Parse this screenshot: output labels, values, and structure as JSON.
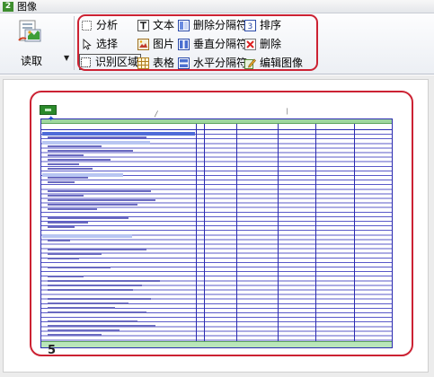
{
  "window": {
    "app_icon_text": "2",
    "title": "图像"
  },
  "ribbon": {
    "read_button": {
      "label": "读取",
      "icon": "scanner-read-icon",
      "dropdown_icon": "dropdown-arrow-icon"
    },
    "tools": [
      {
        "id": "analyze",
        "label": "分析",
        "icon": "analyze-frame-icon"
      },
      {
        "id": "select",
        "label": "选择",
        "icon": "cursor-arrow-icon"
      },
      {
        "id": "recognize",
        "label": "识别区域",
        "icon": "dashed-region-icon",
        "active": true
      },
      {
        "id": "text",
        "label": "文本",
        "icon": "text-T-icon"
      },
      {
        "id": "picture",
        "label": "图片",
        "icon": "picture-icon"
      },
      {
        "id": "table",
        "label": "表格",
        "icon": "table-grid-icon"
      },
      {
        "id": "del-sep",
        "label": "删除分隔符",
        "icon": "delete-separator-icon"
      },
      {
        "id": "vert-sep",
        "label": "垂直分隔符",
        "icon": "vertical-separator-icon"
      },
      {
        "id": "horiz-sep",
        "label": "水平分隔符",
        "icon": "horizontal-separator-icon"
      },
      {
        "id": "sort",
        "label": "排序",
        "icon": "sort-numbered-icon"
      },
      {
        "id": "delete",
        "label": "删除",
        "icon": "delete-x-icon"
      },
      {
        "id": "edit-image",
        "label": "编辑图像",
        "icon": "edit-image-pencil-icon"
      }
    ]
  },
  "document": {
    "page_number": "5",
    "highlight_color": "#cc2233",
    "region_color": "#2a8a2a",
    "table_line_color": "#2b2bb0"
  }
}
